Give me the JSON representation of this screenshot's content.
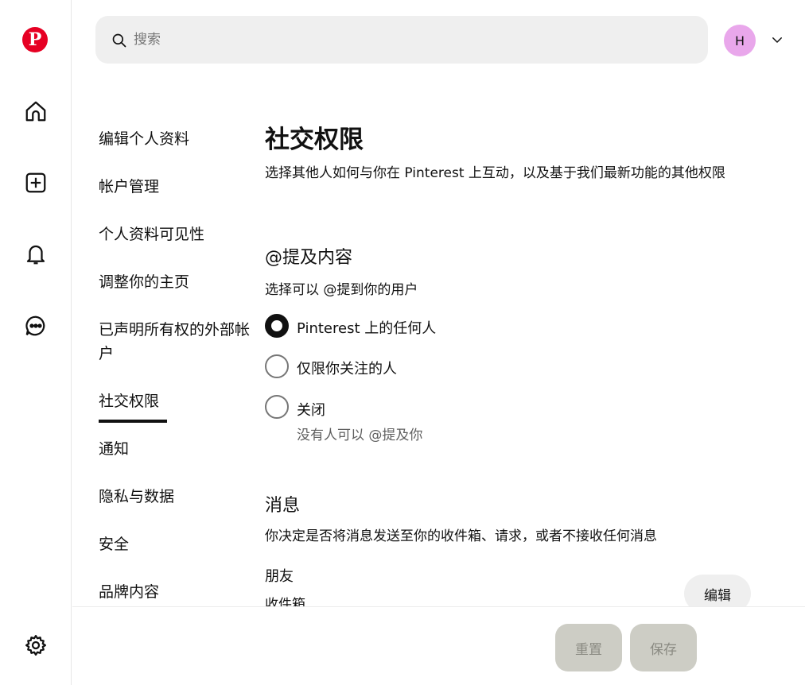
{
  "search": {
    "placeholder": "搜索"
  },
  "header": {
    "avatar_initial": "H"
  },
  "nav": {
    "items": [
      {
        "label": "编辑个人资料"
      },
      {
        "label": "帐户管理"
      },
      {
        "label": "个人资料可见性"
      },
      {
        "label": "调整你的主页"
      },
      {
        "label": "已声明所有权的外部帐户"
      },
      {
        "label": "社交权限"
      },
      {
        "label": "通知"
      },
      {
        "label": "隐私与数据"
      },
      {
        "label": "安全"
      },
      {
        "label": "品牌内容"
      }
    ]
  },
  "main": {
    "title": "社交权限",
    "description": "选择其他人如何与你在 Pinterest 上互动，以及基于我们最新功能的其他权限",
    "mentions": {
      "heading": "@提及内容",
      "subtitle": "选择可以 @提到你的用户",
      "options": [
        {
          "label": "Pinterest 上的任何人",
          "checked": true
        },
        {
          "label": "仅限你关注的人",
          "checked": false
        },
        {
          "label": "关闭",
          "checked": false,
          "help": "没有人可以 @提及你"
        }
      ]
    },
    "messages": {
      "heading": "消息",
      "description": "你决定是否将消息发送至你的收件箱、请求，或者不接收任何消息",
      "friends_label": "朋友",
      "inbox_label": "收件箱",
      "edit_label": "编辑"
    }
  },
  "footer": {
    "reset_label": "重置",
    "save_label": "保存"
  },
  "colors": {
    "brand": "#e60023",
    "avatar": "#e9a7eb",
    "disabled_button": "#cdcdc5"
  }
}
